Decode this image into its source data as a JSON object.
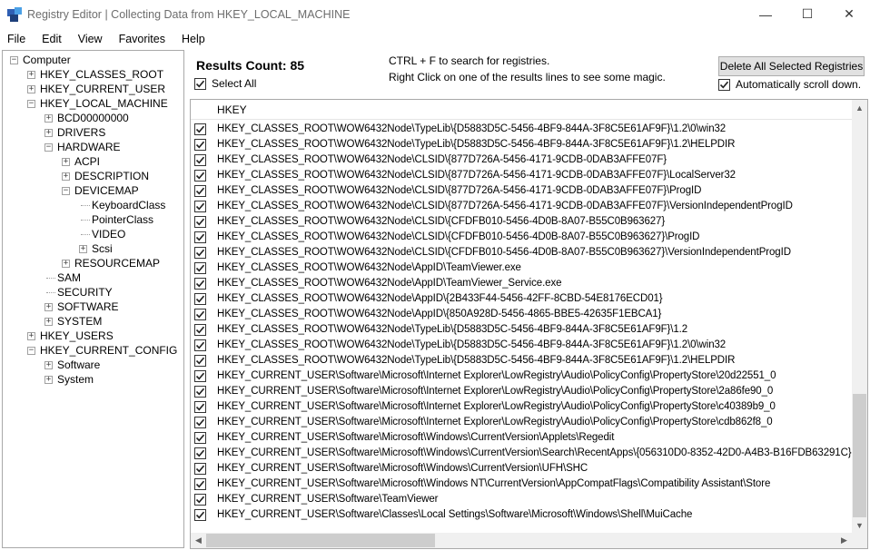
{
  "window": {
    "title": "Registry Editor | Collecting Data from HKEY_LOCAL_MACHINE",
    "minimize": "—",
    "maximize": "☐",
    "close": "✕"
  },
  "menu": [
    "File",
    "Edit",
    "View",
    "Favorites",
    "Help"
  ],
  "tree": {
    "items": [
      {
        "label": "Computer",
        "level": 0,
        "state": "-"
      },
      {
        "label": "HKEY_CLASSES_ROOT",
        "level": 1,
        "state": "+"
      },
      {
        "label": "HKEY_CURRENT_USER",
        "level": 1,
        "state": "+"
      },
      {
        "label": "HKEY_LOCAL_MACHINE",
        "level": 1,
        "state": "-"
      },
      {
        "label": "BCD00000000",
        "level": 2,
        "state": "+"
      },
      {
        "label": "DRIVERS",
        "level": 2,
        "state": "+"
      },
      {
        "label": "HARDWARE",
        "level": 2,
        "state": "-"
      },
      {
        "label": "ACPI",
        "level": 3,
        "state": "+"
      },
      {
        "label": "DESCRIPTION",
        "level": 3,
        "state": "+"
      },
      {
        "label": "DEVICEMAP",
        "level": 3,
        "state": "-"
      },
      {
        "label": "KeyboardClass",
        "level": 4,
        "state": ""
      },
      {
        "label": "PointerClass",
        "level": 4,
        "state": ""
      },
      {
        "label": "VIDEO",
        "level": 4,
        "state": ""
      },
      {
        "label": "Scsi",
        "level": 4,
        "state": "+"
      },
      {
        "label": "RESOURCEMAP",
        "level": 3,
        "state": "+"
      },
      {
        "label": "SAM",
        "level": 2,
        "state": ""
      },
      {
        "label": "SECURITY",
        "level": 2,
        "state": ""
      },
      {
        "label": "SOFTWARE",
        "level": 2,
        "state": "+"
      },
      {
        "label": "SYSTEM",
        "level": 2,
        "state": "+"
      },
      {
        "label": "HKEY_USERS",
        "level": 1,
        "state": "+"
      },
      {
        "label": "HKEY_CURRENT_CONFIG",
        "level": 1,
        "state": "-"
      },
      {
        "label": "Software",
        "level": 2,
        "state": "+"
      },
      {
        "label": "System",
        "level": 2,
        "state": "+"
      }
    ]
  },
  "panel": {
    "results_count": "Results Count: 85",
    "select_all": "Select All",
    "hint_search": "CTRL + F to search for registries.",
    "hint_right_click": "Right Click on one of the results lines to see some magic.",
    "delete_button": "Delete All Selected Registries",
    "auto_scroll": "Automatically scroll down."
  },
  "list": {
    "column_header": "HKEY",
    "rows": [
      "HKEY_CLASSES_ROOT\\WOW6432Node\\TypeLib\\{D5883D5C-5456-4BF9-844A-3F8C5E61AF9F}\\1.2\\0\\win32",
      "HKEY_CLASSES_ROOT\\WOW6432Node\\TypeLib\\{D5883D5C-5456-4BF9-844A-3F8C5E61AF9F}\\1.2\\HELPDIR",
      "HKEY_CLASSES_ROOT\\WOW6432Node\\CLSID\\{877D726A-5456-4171-9CDB-0DAB3AFFE07F}",
      "HKEY_CLASSES_ROOT\\WOW6432Node\\CLSID\\{877D726A-5456-4171-9CDB-0DAB3AFFE07F}\\LocalServer32",
      "HKEY_CLASSES_ROOT\\WOW6432Node\\CLSID\\{877D726A-5456-4171-9CDB-0DAB3AFFE07F}\\ProgID",
      "HKEY_CLASSES_ROOT\\WOW6432Node\\CLSID\\{877D726A-5456-4171-9CDB-0DAB3AFFE07F}\\VersionIndependentProgID",
      "HKEY_CLASSES_ROOT\\WOW6432Node\\CLSID\\{CFDFB010-5456-4D0B-8A07-B55C0B963627}",
      "HKEY_CLASSES_ROOT\\WOW6432Node\\CLSID\\{CFDFB010-5456-4D0B-8A07-B55C0B963627}\\ProgID",
      "HKEY_CLASSES_ROOT\\WOW6432Node\\CLSID\\{CFDFB010-5456-4D0B-8A07-B55C0B963627}\\VersionIndependentProgID",
      "HKEY_CLASSES_ROOT\\WOW6432Node\\AppID\\TeamViewer.exe",
      "HKEY_CLASSES_ROOT\\WOW6432Node\\AppID\\TeamViewer_Service.exe",
      "HKEY_CLASSES_ROOT\\WOW6432Node\\AppID\\{2B433F44-5456-42FF-8CBD-54E8176ECD01}",
      "HKEY_CLASSES_ROOT\\WOW6432Node\\AppID\\{850A928D-5456-4865-BBE5-42635F1EBCA1}",
      "HKEY_CLASSES_ROOT\\WOW6432Node\\TypeLib\\{D5883D5C-5456-4BF9-844A-3F8C5E61AF9F}\\1.2",
      "HKEY_CLASSES_ROOT\\WOW6432Node\\TypeLib\\{D5883D5C-5456-4BF9-844A-3F8C5E61AF9F}\\1.2\\0\\win32",
      "HKEY_CLASSES_ROOT\\WOW6432Node\\TypeLib\\{D5883D5C-5456-4BF9-844A-3F8C5E61AF9F}\\1.2\\HELPDIR",
      "HKEY_CURRENT_USER\\Software\\Microsoft\\Internet Explorer\\LowRegistry\\Audio\\PolicyConfig\\PropertyStore\\20d22551_0",
      "HKEY_CURRENT_USER\\Software\\Microsoft\\Internet Explorer\\LowRegistry\\Audio\\PolicyConfig\\PropertyStore\\2a86fe90_0",
      "HKEY_CURRENT_USER\\Software\\Microsoft\\Internet Explorer\\LowRegistry\\Audio\\PolicyConfig\\PropertyStore\\c40389b9_0",
      "HKEY_CURRENT_USER\\Software\\Microsoft\\Internet Explorer\\LowRegistry\\Audio\\PolicyConfig\\PropertyStore\\cdb862f8_0",
      "HKEY_CURRENT_USER\\Software\\Microsoft\\Windows\\CurrentVersion\\Applets\\Regedit",
      "HKEY_CURRENT_USER\\Software\\Microsoft\\Windows\\CurrentVersion\\Search\\RecentApps\\{056310D0-8352-42D0-A4B3-B16FDB63291C}",
      "HKEY_CURRENT_USER\\Software\\Microsoft\\Windows\\CurrentVersion\\UFH\\SHC",
      "HKEY_CURRENT_USER\\Software\\Microsoft\\Windows NT\\CurrentVersion\\AppCompatFlags\\Compatibility Assistant\\Store",
      "HKEY_CURRENT_USER\\Software\\TeamViewer",
      "HKEY_CURRENT_USER\\Software\\Classes\\Local Settings\\Software\\Microsoft\\Windows\\Shell\\MuiCache"
    ]
  }
}
